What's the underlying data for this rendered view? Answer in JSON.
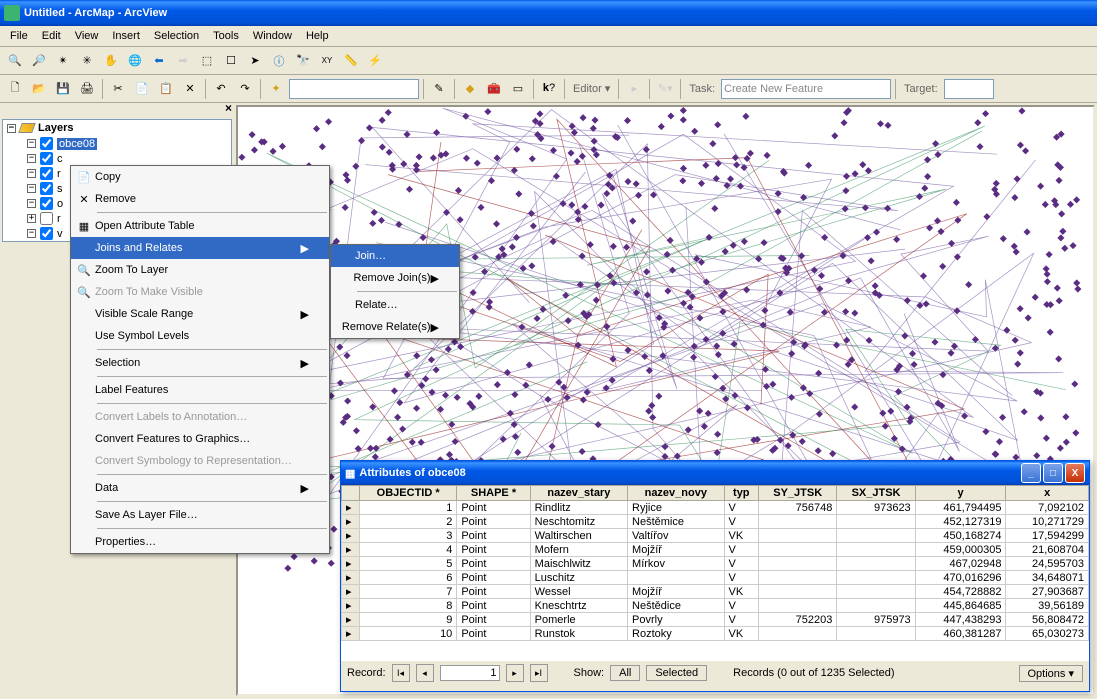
{
  "title": "Untitled - ArcMap - ArcView",
  "menubar": [
    "File",
    "Edit",
    "View",
    "Insert",
    "Selection",
    "Tools",
    "Window",
    "Help"
  ],
  "toolbar2": {
    "editor": "Editor",
    "task": "Task:",
    "task_ph": "Create New Feature",
    "target": "Target:"
  },
  "toc": {
    "header": "Layers",
    "items": [
      {
        "name": "obce08",
        "checked": true,
        "selected": true
      },
      {
        "name": "c",
        "checked": true
      },
      {
        "name": "r",
        "checked": true
      },
      {
        "name": "s",
        "checked": true
      },
      {
        "name": "o",
        "checked": true
      },
      {
        "name": "r",
        "checked": false
      },
      {
        "name": "v",
        "checked": true
      }
    ]
  },
  "ctx": {
    "items": [
      {
        "label": "Copy",
        "icon": "📄"
      },
      {
        "label": "Remove",
        "icon": "✕"
      },
      {
        "div": true
      },
      {
        "label": "Open Attribute Table",
        "icon": "▦"
      },
      {
        "label": "Joins and Relates",
        "hl": true,
        "sub": true
      },
      {
        "label": "Zoom To Layer",
        "icon": "🔍"
      },
      {
        "label": "Zoom To Make Visible",
        "icon": "🔍",
        "dis": true
      },
      {
        "label": "Visible Scale Range",
        "sub": true
      },
      {
        "label": "Use Symbol Levels"
      },
      {
        "div": true
      },
      {
        "label": "Selection",
        "sub": true
      },
      {
        "div": true
      },
      {
        "label": "Label Features"
      },
      {
        "div": true
      },
      {
        "label": "Convert Labels to Annotation…",
        "dis": true
      },
      {
        "label": "Convert Features to Graphics…",
        "icon": ""
      },
      {
        "label": "Convert Symbology to Representation…",
        "dis": true
      },
      {
        "div": true
      },
      {
        "label": "Data",
        "sub": true
      },
      {
        "div": true
      },
      {
        "label": "Save As Layer File…"
      },
      {
        "div": true
      },
      {
        "label": "Properties…",
        "icon": ""
      }
    ],
    "sub": [
      {
        "label": "Join…",
        "hl": true
      },
      {
        "label": "Remove Join(s)",
        "sub": true
      },
      {
        "div": true
      },
      {
        "label": "Relate…"
      },
      {
        "label": "Remove Relate(s)",
        "sub": true
      }
    ]
  },
  "attr": {
    "title": "Attributes of obce08",
    "cols": [
      "OBJECTID *",
      "SHAPE *",
      "nazev_stary",
      "nazev_novy",
      "typ",
      "SY_JTSK",
      "SX_JTSK",
      "y",
      "x"
    ],
    "rows": [
      [
        "1",
        "Point",
        "Rindlitz",
        "Ryjice",
        "V",
        "756748",
        "973623",
        "461,794495",
        "7,092102"
      ],
      [
        "2",
        "Point",
        "Neschtomitz",
        "Neštěmice",
        "V",
        "<Null>",
        "<Null>",
        "452,127319",
        "10,271729"
      ],
      [
        "3",
        "Point",
        "Waltirschen",
        "Valtířov",
        "VK",
        "<Null>",
        "<Null>",
        "450,168274",
        "17,594299"
      ],
      [
        "4",
        "Point",
        "Mofern",
        "Mojžíř",
        "V",
        "<Null>",
        "<Null>",
        "459,000305",
        "21,608704"
      ],
      [
        "5",
        "Point",
        "Maischlwitz",
        "Mírkov",
        "V",
        "<Null>",
        "<Null>",
        "467,02948",
        "24,595703"
      ],
      [
        "6",
        "Point",
        "Luschitz",
        "",
        "V",
        "<Null>",
        "<Null>",
        "470,016296",
        "34,648071"
      ],
      [
        "7",
        "Point",
        "Wessel",
        "Mojžíř",
        "VK",
        "<Null>",
        "<Null>",
        "454,728882",
        "27,903687"
      ],
      [
        "8",
        "Point",
        "Kneschtrtz",
        "Neštědice",
        "V",
        "<Null>",
        "<Null>",
        "445,864685",
        "39,56189"
      ],
      [
        "9",
        "Point",
        "Pomerle",
        "Povrly",
        "V",
        "752203",
        "975973",
        "447,438293",
        "56,808472"
      ],
      [
        "10",
        "Point",
        "Runstok",
        "Roztoky",
        "VK",
        "<Null>",
        "<Null>",
        "460,381287",
        "65,030273"
      ]
    ],
    "foot": {
      "record": "Record:",
      "current": "1",
      "show": "Show:",
      "all": "All",
      "selected": "Selected",
      "status": "Records (0 out of 1235 Selected)",
      "options": "Options"
    }
  }
}
